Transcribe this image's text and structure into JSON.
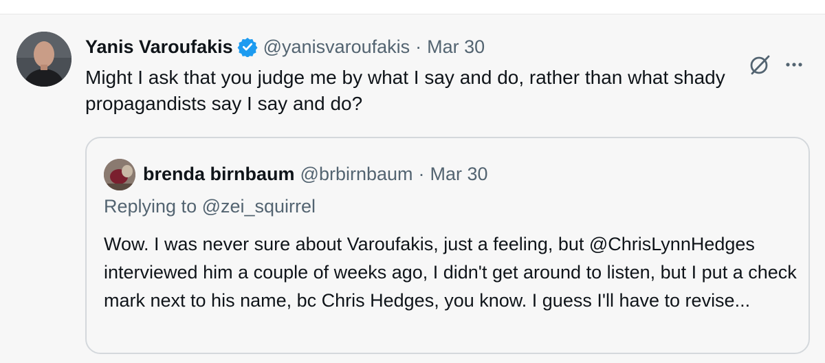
{
  "tweet": {
    "author_name": "Yanis Varoufakis",
    "handle": "@yanisvaroufakis",
    "separator": "·",
    "date": "Mar 30",
    "text": "Might I ask that you judge me by what I say and do, rather than what shady propagandists say I say and do?",
    "icons": {
      "avatar": "profile-photo",
      "verified": "verified-badge-icon",
      "grok": "grok-icon",
      "more": "more-options-icon"
    }
  },
  "quote": {
    "author_name": "brenda birnbaum",
    "handle": "@brbirnbaum",
    "separator": "·",
    "date": "Mar 30",
    "replying_to": "Replying to @zei_squirrel",
    "text": "Wow. I was never sure about Varoufakis, just a feeling, but @ChrisLynnHedges interviewed him a couple of weeks ago, I didn't get around to listen, but I put a check mark next to his name, bc Chris Hedges, you know. I guess I'll have to revise..."
  },
  "colors": {
    "background": "#f7f7f7",
    "text_primary": "#0f1419",
    "text_secondary": "#536471",
    "verified_blue": "#1d9bf0",
    "border": "#d4d8dc"
  }
}
